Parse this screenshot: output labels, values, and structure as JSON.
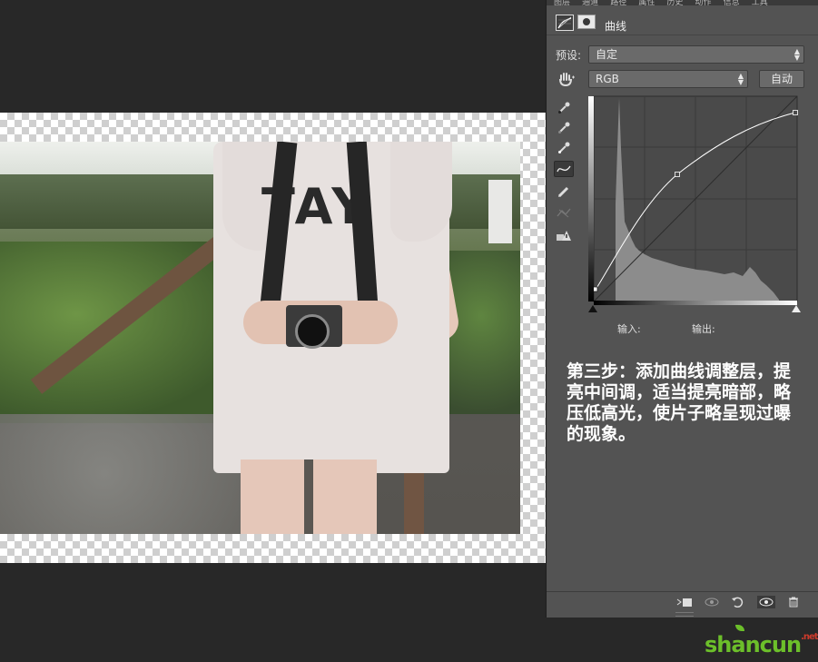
{
  "canvas": {
    "shirt_text": "TAY"
  },
  "panel": {
    "tabs": [
      "图层",
      "通道",
      "路径",
      "属性",
      "历史",
      "动作",
      "信息",
      "工具"
    ],
    "title": "曲线",
    "preset_label": "预设:",
    "preset_value": "自定",
    "channel_value": "RGB",
    "auto_label": "自动",
    "input_label": "输入:",
    "output_label": "输出:",
    "icons": {
      "adjustment": "curves-adjustment-icon",
      "mask": "layer-mask-icon",
      "hand": "targeted-adjust-hand-icon",
      "tools": [
        "eyedropper-black-icon",
        "eyedropper-gray-icon",
        "eyedropper-white-icon",
        "curve-edit-icon",
        "pencil-icon",
        "smooth-curve-icon",
        "clipping-warning-icon"
      ],
      "bottom": [
        "clip-to-layer-icon",
        "view-previous-icon",
        "reset-icon",
        "visibility-eye-icon",
        "trash-icon"
      ]
    }
  },
  "annotation": {
    "text": "第三步：添加曲线调整层，提亮中间调，适当提亮暗部，略压低高光，使片子略呈现过曝的现象。"
  },
  "watermark": {
    "main": "shancun",
    "suffix": ".net"
  },
  "colors": {
    "panel_bg": "#535353",
    "app_bg": "#282828",
    "watermark_green": "#6cbf2a",
    "annotation_text": "#ffffff"
  }
}
